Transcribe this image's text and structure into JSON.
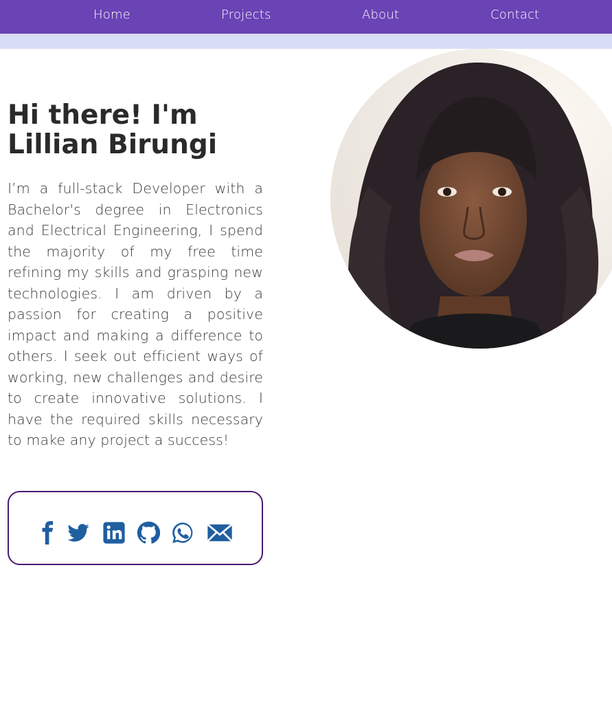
{
  "nav": {
    "items": [
      {
        "label": "Home"
      },
      {
        "label": "Projects"
      },
      {
        "label": "About"
      },
      {
        "label": "Contact"
      }
    ]
  },
  "hero": {
    "title_line1": "Hi there! I'm",
    "title_line2": "Lillian Birungi",
    "bio": "I’m a full-stack Developer with a Bachelor's degree in Electronics and Electrical Engineering, I spend the majority of my free time refining my skills and grasping new technologies. I am driven by a passion for creating a positive impact and making a difference to others. I seek out efficient ways of working, new challenges and desire to create innovative solutions. I have the required skills necessary to make any project a success!"
  },
  "social": {
    "icons": [
      "facebook-icon",
      "twitter-icon",
      "linkedin-icon",
      "github-icon",
      "whatsapp-icon",
      "email-icon"
    ]
  },
  "colors": {
    "navbar": "#6a43b5",
    "subbar": "#d9dcf5",
    "icon_blue": "#1f5fa0",
    "box_border": "#4a1a6e",
    "text": "#2b2b2b"
  }
}
